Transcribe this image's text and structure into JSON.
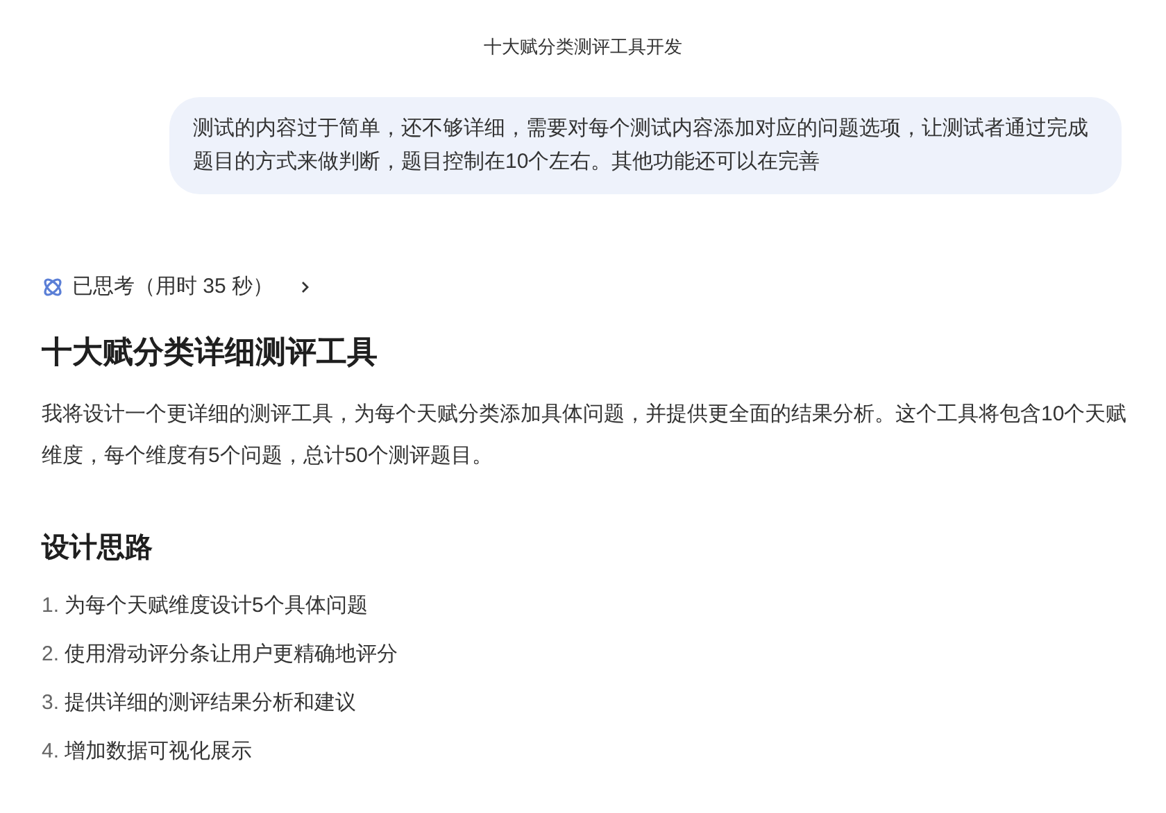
{
  "window": {
    "title": "十大赋分类测评工具开发"
  },
  "user_message": "测试的内容过于简单，还不够详细，需要对每个测试内容添加对应的问题选项，让测试者通过完成题目的方式来做判断，题目控制在10个左右。其他功能还可以在完善",
  "thinking": {
    "label": "已思考（用时 35 秒）",
    "expanded": false
  },
  "heading": "十大赋分类详细测评工具",
  "intro": "我将设计一个更详细的测评工具，为每个天赋分类添加具体问题，并提供更全面的结果分析。这个工具将包含10个天赋维度，每个维度有5个问题，总计50个测评题目。",
  "section_heading": "设计思路",
  "steps": [
    {
      "number": "1.",
      "text": "为每个天赋维度设计5个具体问题"
    },
    {
      "number": "2.",
      "text": "使用滑动评分条让用户更精确地评分"
    },
    {
      "number": "3.",
      "text": "提供详细的测评结果分析和建议"
    },
    {
      "number": "4.",
      "text": "增加数据可视化展示"
    }
  ]
}
